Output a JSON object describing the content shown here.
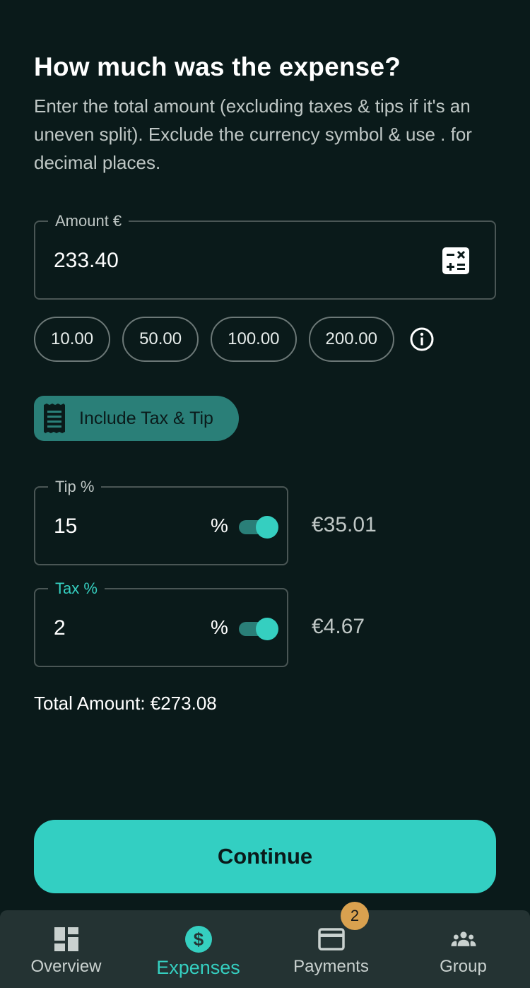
{
  "header": {
    "title": "How much was the expense?",
    "subtitle": "Enter the total amount (excluding taxes & tips if it's an uneven split). Exclude the currency symbol & use . for decimal places."
  },
  "amount": {
    "label": "Amount €",
    "value": "233.40",
    "icon": "calculator-icon"
  },
  "quick_amounts": [
    "10.00",
    "50.00",
    "100.00",
    "200.00"
  ],
  "tax_tip_toggle": {
    "label": "Include Tax & Tip",
    "icon": "receipt-icon"
  },
  "tip": {
    "label": "Tip %",
    "value": "15",
    "unit": "%",
    "enabled": true,
    "computed": "€35.01"
  },
  "tax": {
    "label": "Tax %",
    "value": "2",
    "unit": "%",
    "enabled": true,
    "computed": "€4.67"
  },
  "total": "Total Amount: €273.08",
  "continue_label": "Continue",
  "nav": {
    "items": [
      {
        "label": "Overview",
        "icon": "dashboard-icon"
      },
      {
        "label": "Expenses",
        "icon": "dollar-icon",
        "active": true
      },
      {
        "label": "Payments",
        "icon": "card-icon",
        "badge": "2"
      },
      {
        "label": "Group",
        "icon": "group-icon"
      }
    ]
  },
  "colors": {
    "accent": "#35cfc0",
    "background": "#0a1a1a",
    "badge": "#d9a14f"
  }
}
